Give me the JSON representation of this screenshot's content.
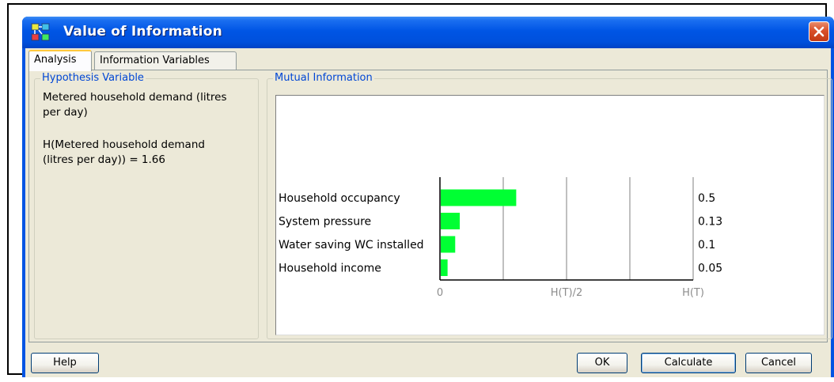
{
  "window": {
    "title": "Value of Information"
  },
  "tabs": [
    {
      "label": "Analysis",
      "active": true
    },
    {
      "label": "Information Variables",
      "active": false
    }
  ],
  "hypothesis": {
    "group_title": "Hypothesis Variable",
    "variable_line1": "Metered household demand (litres",
    "variable_line2": "per day)",
    "entropy_line1": "H(Metered household demand",
    "entropy_line2": "(litres per day)) = 1.66"
  },
  "mutual_information": {
    "group_title": "Mutual Information"
  },
  "chart_data": {
    "type": "bar",
    "orientation": "horizontal",
    "categories": [
      "Household  occupancy",
      "System  pressure",
      "Water saving WC installed",
      "Household income"
    ],
    "values": [
      0.5,
      0.13,
      0.1,
      0.05
    ],
    "value_labels": [
      "0.5",
      "0.13",
      "0.1",
      "0.05"
    ],
    "xlim": [
      0,
      1.66
    ],
    "x_ticks": [
      "0",
      "H(T)/2",
      "H(T)"
    ],
    "bar_color": "#00ff33",
    "grid": true
  },
  "buttons": {
    "help": "Help",
    "ok": "OK",
    "calculate": "Calculate",
    "cancel": "Cancel"
  },
  "colors": {
    "title_bar": "#0054e3",
    "group_title": "#0046d5",
    "close_button": "#d9502a"
  }
}
